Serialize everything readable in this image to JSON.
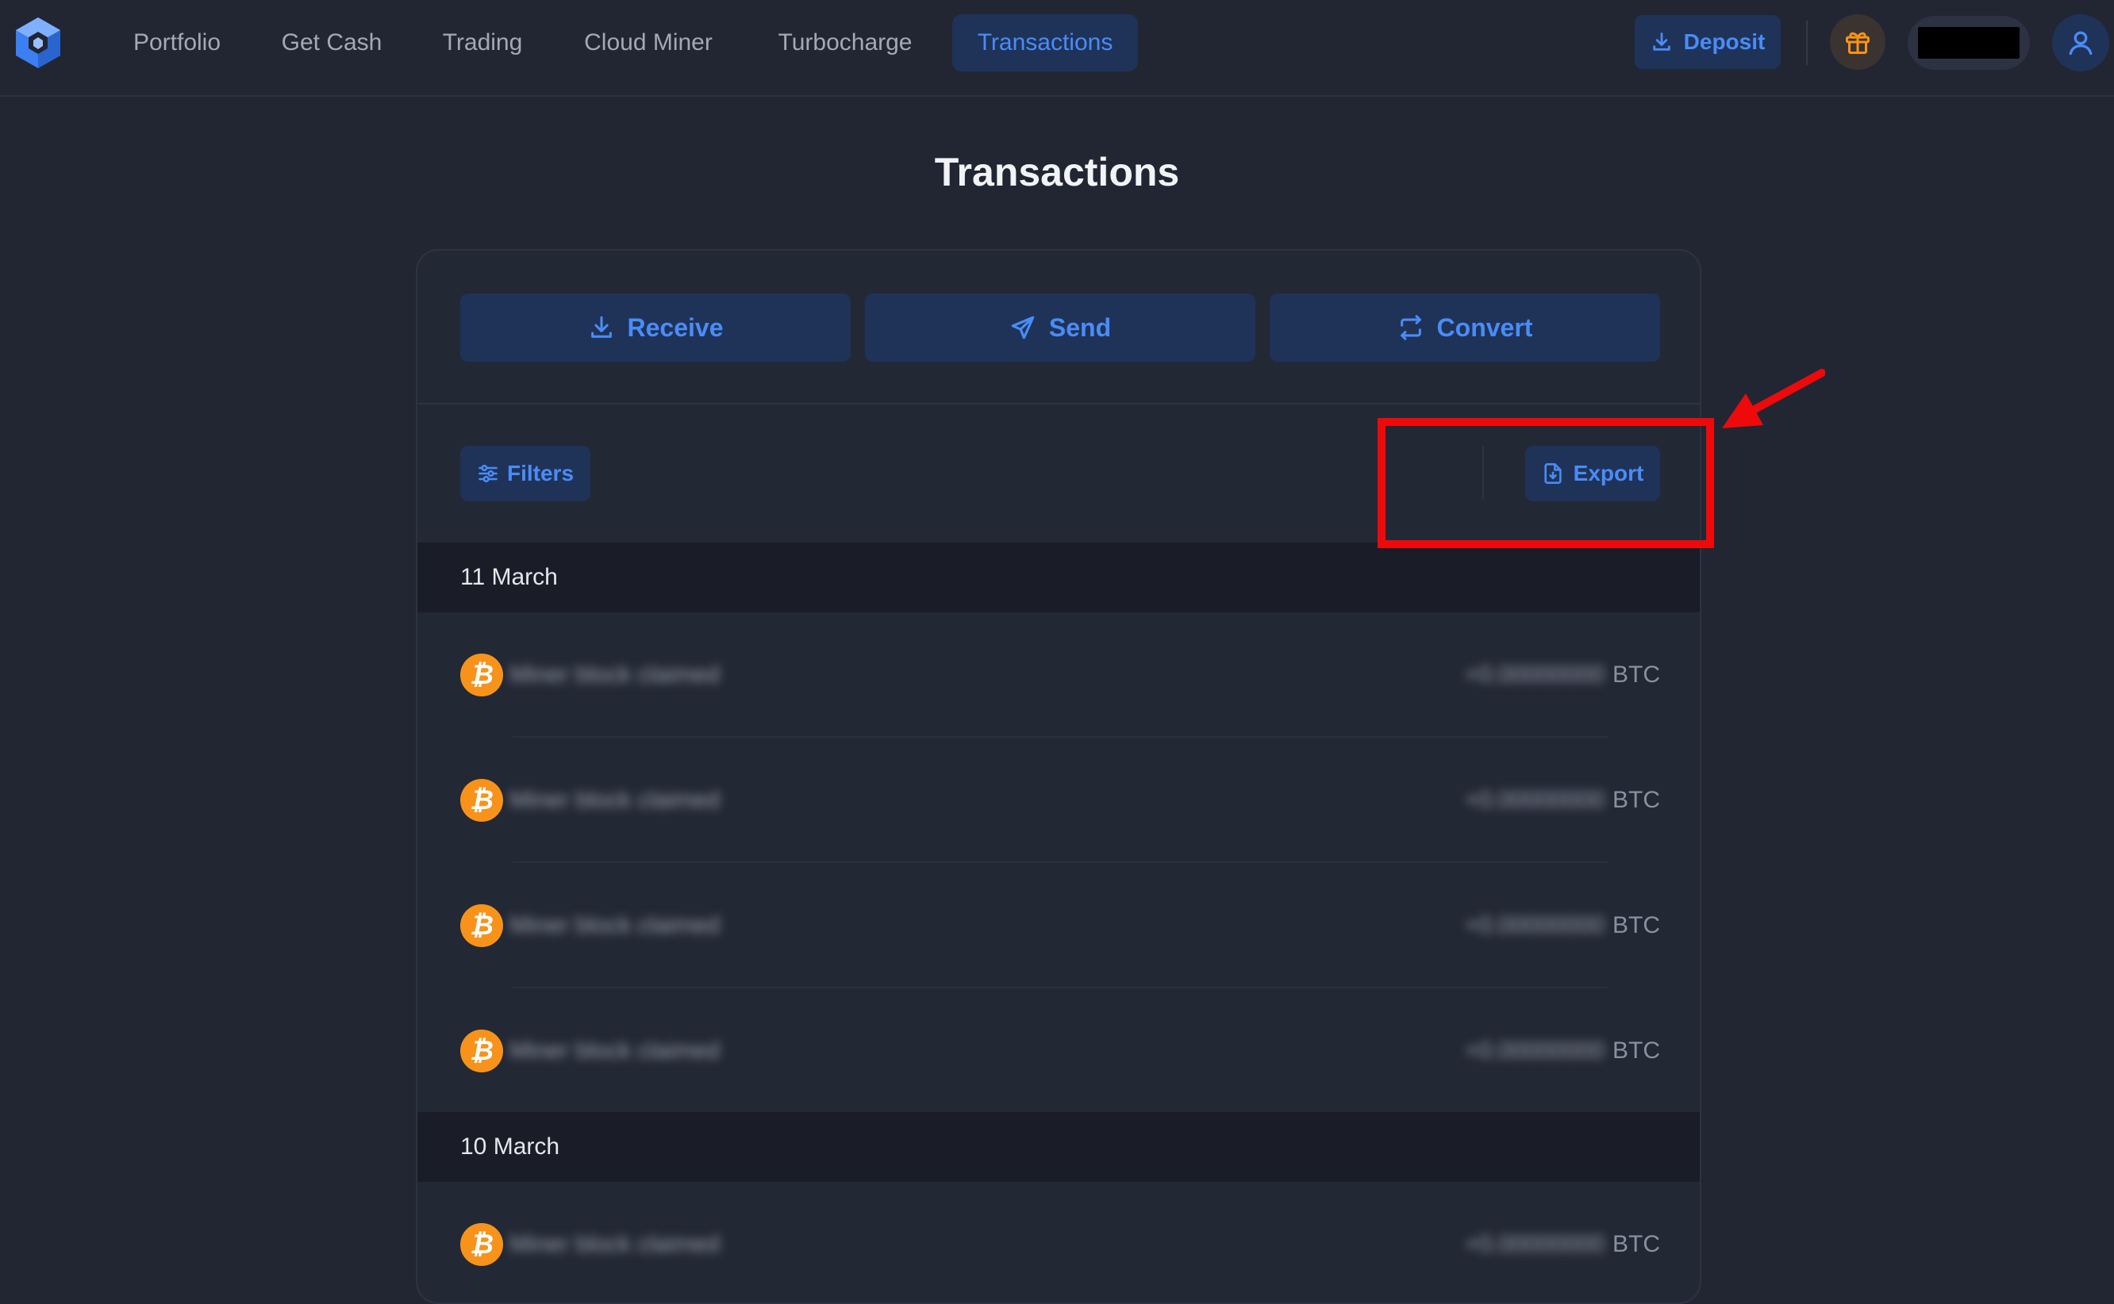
{
  "nav": {
    "items": [
      {
        "label": "Portfolio"
      },
      {
        "label": "Get Cash"
      },
      {
        "label": "Trading"
      },
      {
        "label": "Cloud Miner"
      },
      {
        "label": "Turbocharge"
      },
      {
        "label": "Transactions",
        "active": true
      }
    ],
    "deposit_label": "Deposit",
    "gift_icon": "gift-icon",
    "user_icon": "user-icon"
  },
  "page": {
    "title": "Transactions"
  },
  "actions": {
    "receive_label": "Receive",
    "send_label": "Send",
    "convert_label": "Convert"
  },
  "toolbar": {
    "filters_label": "Filters",
    "export_label": "Export"
  },
  "groups": [
    {
      "date": "11 March",
      "rows": [
        {
          "label": "Miner block claimed",
          "amount": "+0.00000000",
          "currency": "BTC"
        },
        {
          "label": "Miner block claimed",
          "amount": "+0.00000000",
          "currency": "BTC"
        },
        {
          "label": "Miner block claimed",
          "amount": "+0.00000000",
          "currency": "BTC"
        },
        {
          "label": "Miner block claimed",
          "amount": "+0.00000000",
          "currency": "BTC"
        }
      ]
    },
    {
      "date": "10 March",
      "rows": [
        {
          "label": "Miner block claimed",
          "amount": "+0.00000000",
          "currency": "BTC"
        }
      ]
    }
  ],
  "colors": {
    "background": "#222633",
    "accent": "#4a8cf7",
    "button_bg": "#1f3359",
    "bitcoin": "#f7931a",
    "annotation": "#ee0a0a"
  }
}
